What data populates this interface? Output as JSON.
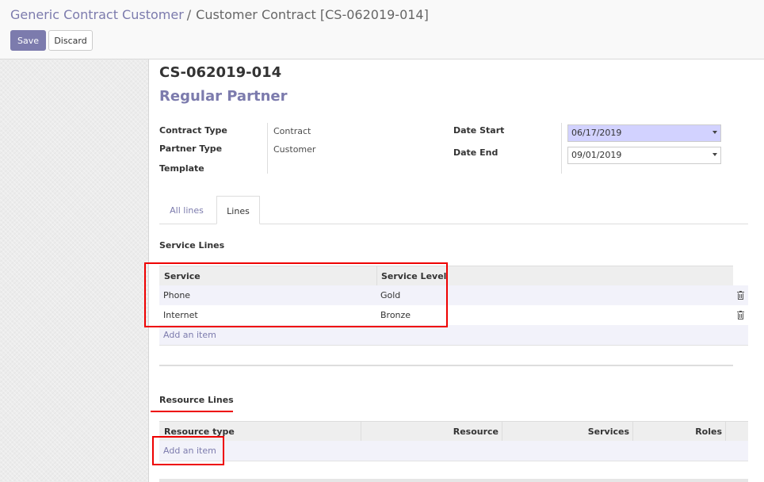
{
  "breadcrumb": {
    "parent": "Generic Contract Customer",
    "separator": "/",
    "current": "Customer Contract [CS-062019-014]"
  },
  "buttons": {
    "save": "Save",
    "discard": "Discard"
  },
  "record": {
    "name": "CS-062019-014",
    "partner": "Regular Partner",
    "fields_left": [
      {
        "label": "Contract Type",
        "value": "Contract"
      },
      {
        "label": "Partner Type",
        "value": "Customer"
      },
      {
        "label": "Template",
        "value": ""
      }
    ],
    "date_start_label": "Date Start",
    "date_start": "06/17/2019",
    "date_end_label": "Date End",
    "date_end": "09/01/2019"
  },
  "tabs": [
    {
      "label": "All lines",
      "active": false
    },
    {
      "label": "Lines",
      "active": true
    }
  ],
  "service_lines": {
    "title": "Service Lines",
    "headers": [
      "Service",
      "Service Level"
    ],
    "rows": [
      [
        "Phone",
        "Gold"
      ],
      [
        "Internet",
        "Bronze"
      ]
    ],
    "add_item": "Add an item"
  },
  "resource_lines": {
    "title": "Resource Lines",
    "headers": [
      "Resource type",
      "Resource",
      "Services",
      "Roles"
    ],
    "add_item": "Add an item"
  },
  "colors": {
    "brand": "#7c7bad",
    "annotation_red": "#e00000",
    "date_start_highlight": "#d2d2ff"
  }
}
